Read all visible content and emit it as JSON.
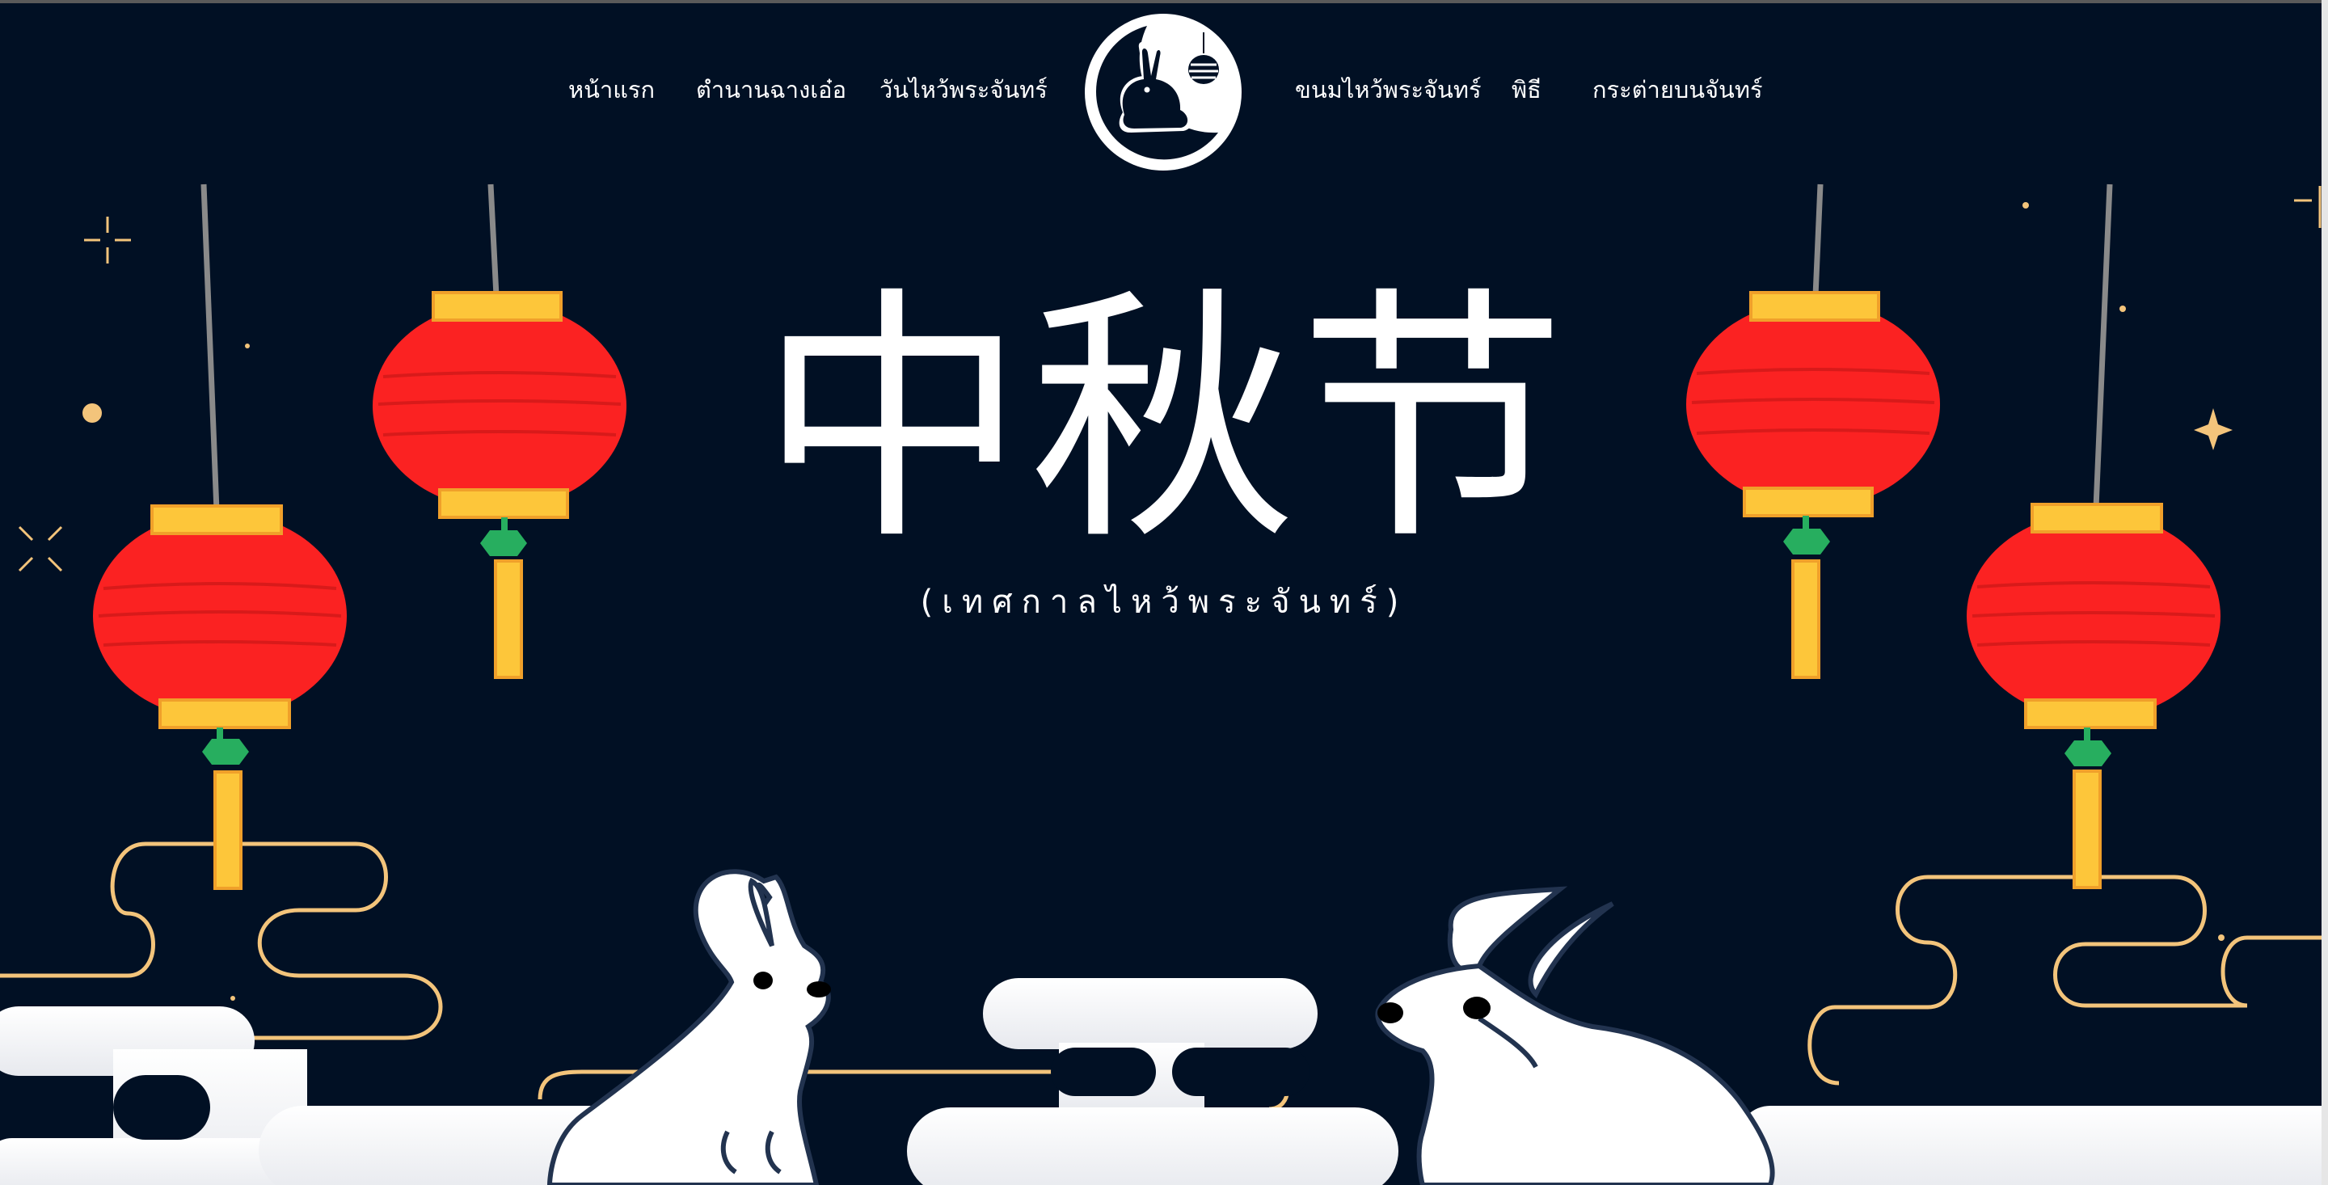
{
  "nav": {
    "items": [
      {
        "label": "หน้าแรก"
      },
      {
        "label": "ตำนานฉางเอ๋อ"
      },
      {
        "label": "วันไหว้พระจันทร์"
      },
      {
        "label": "ขนมไหว้พระจันทร์"
      },
      {
        "label": "พิธี"
      },
      {
        "label": "กระต่ายบนจันทร์"
      }
    ],
    "logo_icon": "moon-rabbit-lantern-logo"
  },
  "hero": {
    "title": "中秋节",
    "subtitle": "(เทศกาลไหว้พระจันทร์)"
  },
  "colors": {
    "background": "#011024",
    "lantern_red": "#fb2222",
    "lantern_gold": "#fdc63a",
    "tassel_knot": "#27ae5f",
    "cloud_line": "#f3c47b",
    "rabbit": "#ffffff"
  }
}
